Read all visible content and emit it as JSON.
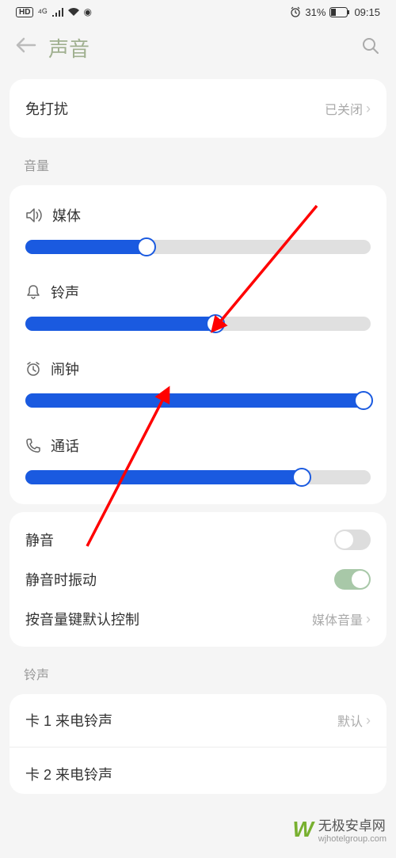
{
  "status_bar": {
    "hd": "HD",
    "signal": "⁴ᴳ",
    "battery_pct": "31%",
    "time": "09:15"
  },
  "header": {
    "title": "声音"
  },
  "dnd": {
    "label": "免打扰",
    "value": "已关闭"
  },
  "volume_section_title": "音量",
  "sliders": {
    "media": {
      "label": "媒体",
      "percent": 35
    },
    "ring": {
      "label": "铃声",
      "percent": 55
    },
    "alarm": {
      "label": "闹钟",
      "percent": 98
    },
    "call": {
      "label": "通话",
      "percent": 80
    }
  },
  "options": {
    "silent": {
      "label": "静音",
      "on": false
    },
    "vibrate_on_silent": {
      "label": "静音时振动",
      "on": true
    },
    "volume_key_default": {
      "label": "按音量键默认控制",
      "value": "媒体音量"
    }
  },
  "ringtone_section_title": "铃声",
  "ringtones": {
    "sim1": {
      "label": "卡 1 来电铃声",
      "value": "默认"
    },
    "sim2": {
      "label": "卡 2 来电铃声"
    }
  },
  "watermark": {
    "main": "无极安卓网",
    "sub": "wjhotelgroup.com"
  },
  "colors": {
    "accent": "#1a5ae0",
    "green_title": "#a0b090",
    "annotation": "#ff0000"
  }
}
